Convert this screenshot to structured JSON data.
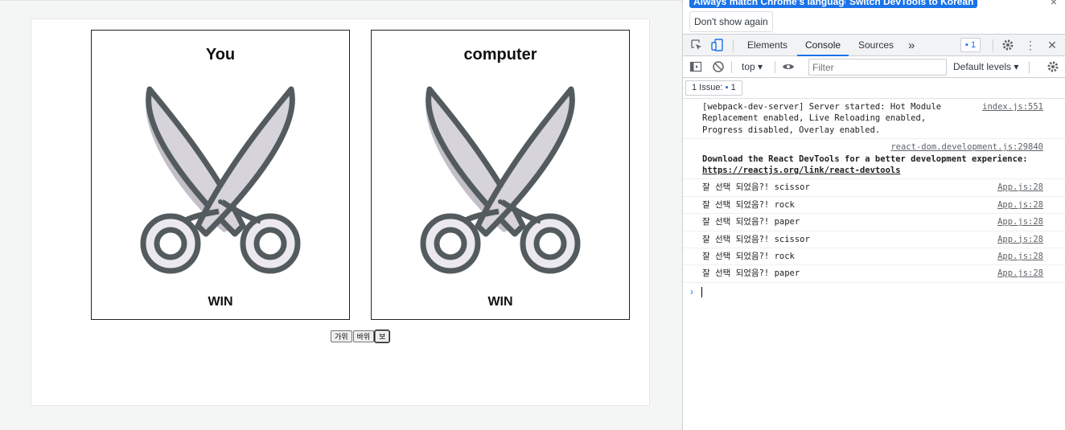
{
  "game": {
    "player_title": "You",
    "computer_title": "computer",
    "player_result": "WIN",
    "computer_result": "WIN",
    "player_choice_icon": "scissors-icon",
    "computer_choice_icon": "scissors-icon",
    "buttons": [
      "가위",
      "바위",
      "보"
    ]
  },
  "devtools": {
    "infobar": {
      "match_language": "Always match Chrome's language",
      "switch_korean": "Switch DevTools to Korean",
      "dont_show": "Don't show again",
      "close": "×"
    },
    "tabs": [
      "Elements",
      "Console",
      "Sources"
    ],
    "more_tabs": "»",
    "issues_badge": "1",
    "toolbar": {
      "context": "top",
      "filter_placeholder": "Filter",
      "levels": "Default levels"
    },
    "issues_label": "1 Issue:",
    "issues_count": "1",
    "messages": [
      {
        "text": "[webpack-dev-server] Server started: Hot Module Replacement enabled, Live Reloading enabled, Progress disabled, Overlay enabled.",
        "source": "index.js:551"
      },
      {
        "source": "react-dom.development.js:29840",
        "text": "Download the React DevTools for a better development experience: ",
        "link": "https://reactjs.org/link/react-devtools"
      },
      {
        "text": "잘 선택 되었음?! scissor",
        "source": "App.js:28"
      },
      {
        "text": "잘 선택 되었음?! rock",
        "source": "App.js:28"
      },
      {
        "text": "잘 선택 되었음?! paper",
        "source": "App.js:28"
      },
      {
        "text": "잘 선택 되었음?! scissor",
        "source": "App.js:28"
      },
      {
        "text": "잘 선택 되었음?! rock",
        "source": "App.js:28"
      },
      {
        "text": "잘 선택 되었음?! paper",
        "source": "App.js:28"
      }
    ],
    "prompt": "›"
  },
  "colors": {
    "accent": "#1a73e8",
    "scissor_outline": "#545b5f",
    "scissor_blade": "#d6d3da",
    "scissor_shade": "#c3bec8"
  }
}
